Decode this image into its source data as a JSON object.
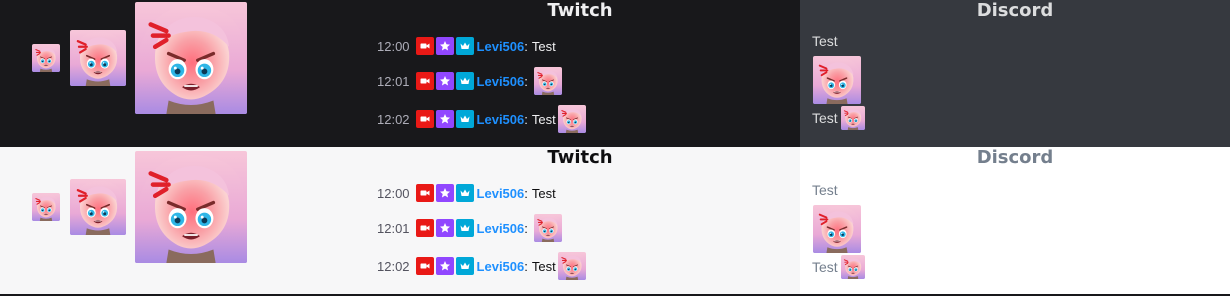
{
  "emote": {
    "name": "angry-girl-emote",
    "icon": "angry-girl-emote"
  },
  "panels": [
    {
      "theme": "dark",
      "twitch": {
        "title": "Twitch",
        "messages": [
          {
            "time": "12:00",
            "user": "Levi506",
            "colon": ":",
            "text": "Test",
            "emote": false
          },
          {
            "time": "12:01",
            "user": "Levi506",
            "colon": ":",
            "text": "",
            "emote": true
          },
          {
            "time": "12:02",
            "user": "Levi506",
            "colon": ":",
            "text": "Test",
            "emote": true
          }
        ]
      },
      "discord": {
        "title": "Discord",
        "line1": "Test",
        "line2": "Test"
      }
    },
    {
      "theme": "light",
      "twitch": {
        "title": "Twitch",
        "messages": [
          {
            "time": "12:00",
            "user": "Levi506",
            "colon": ":",
            "text": "Test",
            "emote": false
          },
          {
            "time": "12:01",
            "user": "Levi506",
            "colon": ":",
            "text": "",
            "emote": true
          },
          {
            "time": "12:02",
            "user": "Levi506",
            "colon": ":",
            "text": "Test",
            "emote": true
          }
        ]
      },
      "discord": {
        "title": "Discord",
        "line1": "Test",
        "line2": "Test"
      }
    }
  ],
  "badges": [
    {
      "name": "video-badge",
      "icon": "video-camera-icon",
      "color": "#e91916"
    },
    {
      "name": "vip-badge",
      "icon": "star-icon",
      "color": "#9147ff"
    },
    {
      "name": "subscriber-badge",
      "icon": "crown-icon",
      "color": "#00a8d8"
    }
  ],
  "colors": {
    "username": "#1e90ff",
    "twitch_dark_bg": "#18181b",
    "twitch_light_bg": "#f7f7f8",
    "discord_dark_bg": "#36393f",
    "discord_light_bg": "#ffffff"
  }
}
